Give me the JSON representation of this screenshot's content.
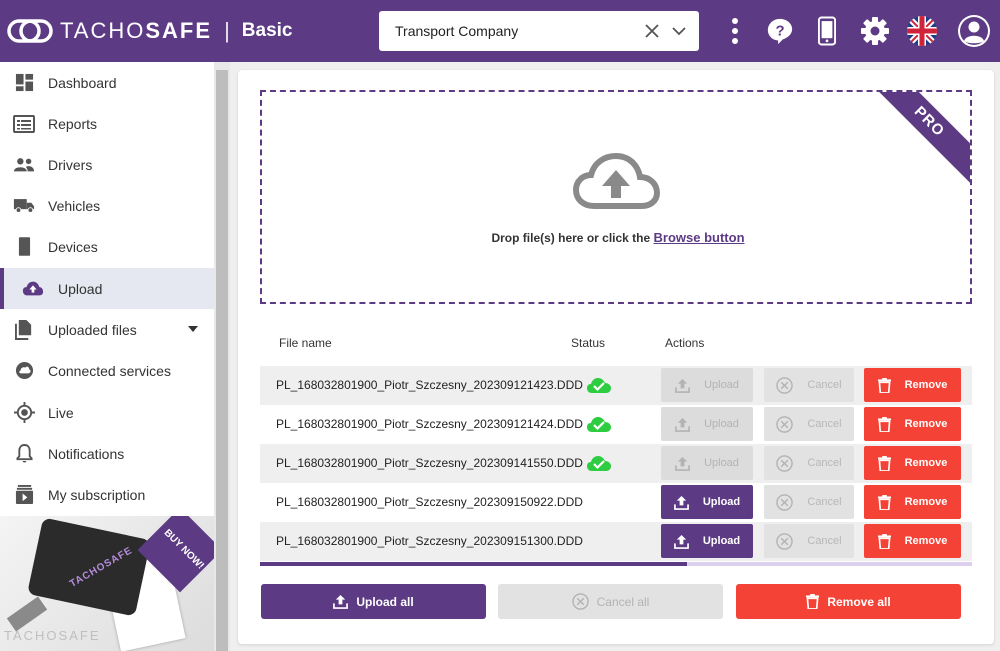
{
  "header": {
    "logo_light": "TACHO",
    "logo_bold": "SAFE",
    "separator": "|",
    "plan": "Basic",
    "company": "Transport Company",
    "icons": [
      "more-vert-icon",
      "help-icon",
      "phone-icon",
      "gear-icon",
      "uk-flag-icon",
      "account-icon"
    ]
  },
  "sidebar": {
    "items": [
      {
        "label": "Dashboard",
        "icon": "dashboard-icon"
      },
      {
        "label": "Reports",
        "icon": "reports-icon"
      },
      {
        "label": "Drivers",
        "icon": "drivers-icon"
      },
      {
        "label": "Vehicles",
        "icon": "truck-icon"
      },
      {
        "label": "Devices",
        "icon": "device-icon"
      },
      {
        "label": "Upload",
        "icon": "cloud-upload-icon",
        "active": true
      },
      {
        "label": "Uploaded files",
        "icon": "files-icon",
        "has_submenu": true
      },
      {
        "label": "Connected services",
        "icon": "cloud-icon"
      },
      {
        "label": "Live",
        "icon": "target-icon"
      },
      {
        "label": "Notifications",
        "icon": "bell-icon"
      },
      {
        "label": "My subscription",
        "icon": "subscription-icon"
      }
    ],
    "promo": {
      "badge": "BUY NOW!",
      "brand": "TACHOSAFE",
      "device_brand": "TACHOSAFE"
    }
  },
  "dropzone": {
    "text": "Drop file(s) here or click the ",
    "browse": "Browse button",
    "ribbon": "PRO"
  },
  "table": {
    "headers": {
      "file": "File name",
      "status": "Status",
      "actions": "Actions"
    },
    "rows": [
      {
        "file": "PL_168032801900_Piotr_Szczesny_202309121423.DDD",
        "uploaded": true
      },
      {
        "file": "PL_168032801900_Piotr_Szczesny_202309121424.DDD",
        "uploaded": true
      },
      {
        "file": "PL_168032801900_Piotr_Szczesny_202309141550.DDD",
        "uploaded": true
      },
      {
        "file": "PL_168032801900_Piotr_Szczesny_202309150922.DDD",
        "uploaded": false
      },
      {
        "file": "PL_168032801900_Piotr_Szczesny_202309151300.DDD",
        "uploaded": false
      }
    ],
    "upload_label": "Upload",
    "cancel_label": "Cancel",
    "remove_label": "Remove"
  },
  "progress": {
    "fraction": 0.6
  },
  "footer": {
    "upload_all": "Upload all",
    "cancel_all": "Cancel all",
    "remove_all": "Remove all"
  },
  "colors": {
    "brand": "#5d3b84",
    "danger": "#f44336",
    "success": "#2ecc40",
    "disabled": "#e2e2e2"
  }
}
